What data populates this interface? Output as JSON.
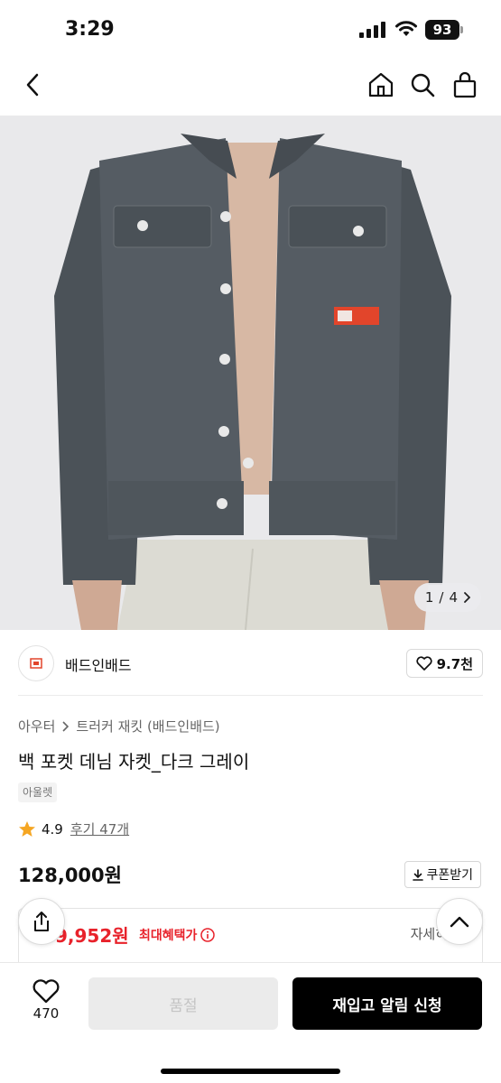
{
  "status": {
    "time": "3:29",
    "battery": "93"
  },
  "product": {
    "image_counter": {
      "current": "1",
      "separator": "/",
      "total": "4"
    },
    "brand": {
      "name": "배드인배드",
      "likes": "9.7천"
    },
    "breadcrumb": {
      "category": "아우터",
      "subcategory": "트러커 재킷 (배드인배드)"
    },
    "title": "백 포켓 데님 자켓_다크 그레이",
    "tag": "아울렛",
    "rating": {
      "score": "4.9",
      "reviews": "후기 47개"
    },
    "price": "128,000원",
    "coupon_label": "쿠폰받기",
    "benefit": {
      "price": "9,952원",
      "label": "최대혜택가",
      "detail": "자세히"
    }
  },
  "bottom": {
    "wish_count": "470",
    "soldout_label": "품절",
    "restock_label": "재입고 알림 신청"
  },
  "colors": {
    "accent_red": "#e8222b",
    "star": "#f5a623",
    "primary_button": "#000000"
  }
}
